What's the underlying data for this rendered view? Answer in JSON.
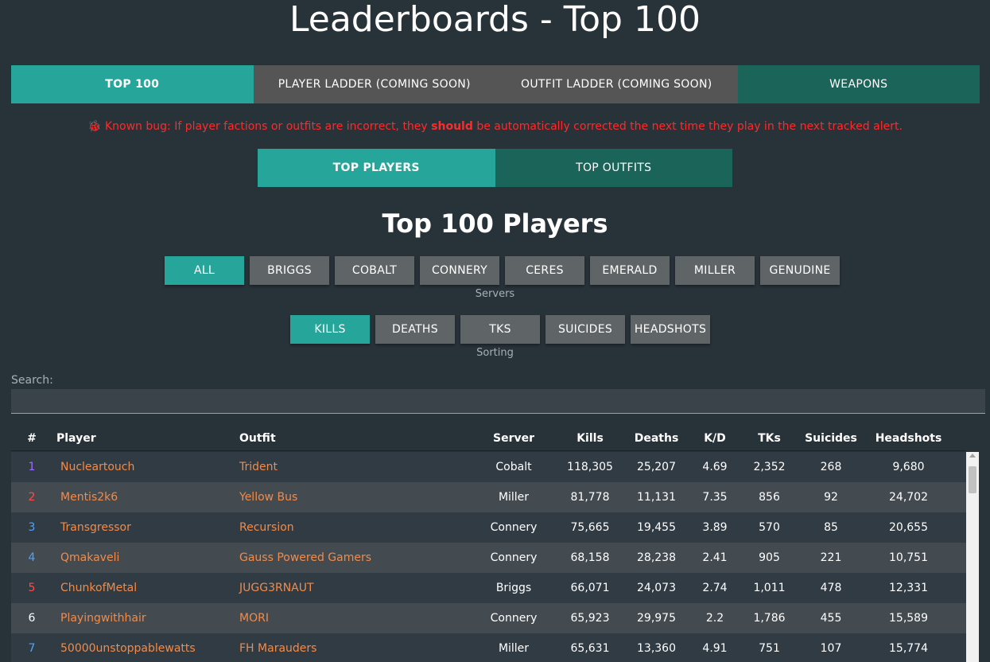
{
  "page_title": "Leaderboards - Top 100",
  "main_tabs": [
    {
      "label": "TOP 100"
    },
    {
      "label": "PLAYER LADDER (COMING SOON)"
    },
    {
      "label": "OUTFIT LADDER (COMING SOON)"
    },
    {
      "label": "WEAPONS"
    }
  ],
  "notice": {
    "icon": "bug-icon",
    "glyph": "🐞",
    "prefix": " Known bug: If player factions or outfits are incorrect, they ",
    "emphasis": "should",
    "suffix": " be automatically corrected the next time they play in the next tracked alert."
  },
  "sub_tabs": [
    {
      "label": "TOP PLAYERS"
    },
    {
      "label": "TOP OUTFITS"
    }
  ],
  "section_title": "Top 100 Players",
  "servers": {
    "buttons": [
      "ALL",
      "BRIGGS",
      "COBALT",
      "CONNERY",
      "CERES",
      "EMERALD",
      "MILLER",
      "GENUDINE"
    ],
    "selected": "ALL",
    "caption": "Servers"
  },
  "sorting": {
    "buttons": [
      "KILLS",
      "DEATHS",
      "TKS",
      "SUICIDES",
      "HEADSHOTS"
    ],
    "selected": "KILLS",
    "caption": "Sorting"
  },
  "search": {
    "label": "Search:",
    "value": "",
    "placeholder": ""
  },
  "table": {
    "headers": {
      "rank": "#",
      "player": "Player",
      "outfit": "Outfit",
      "server": "Server",
      "kills": "Kills",
      "deaths": "Deaths",
      "kd": "K/D",
      "tks": "TKs",
      "suicides": "Suicides",
      "headshots": "Headshots"
    },
    "rows": [
      {
        "rank": "1",
        "faction": "vs",
        "player": "Nucleartouch",
        "outfit": "Trident",
        "server": "Cobalt",
        "kills": "118,305",
        "deaths": "25,207",
        "kd": "4.69",
        "tks": "2,352",
        "suicides": "268",
        "headshots": "9,680"
      },
      {
        "rank": "2",
        "faction": "tr",
        "player": "Mentis2k6",
        "outfit": "Yellow Bus",
        "server": "Miller",
        "kills": "81,778",
        "deaths": "11,131",
        "kd": "7.35",
        "tks": "856",
        "suicides": "92",
        "headshots": "24,702"
      },
      {
        "rank": "3",
        "faction": "nc",
        "player": "Transgressor",
        "outfit": "Recursion",
        "server": "Connery",
        "kills": "75,665",
        "deaths": "19,455",
        "kd": "3.89",
        "tks": "570",
        "suicides": "85",
        "headshots": "20,655"
      },
      {
        "rank": "4",
        "faction": "nc",
        "player": "Qmakaveli",
        "outfit": "Gauss Powered Gamers",
        "server": "Connery",
        "kills": "68,158",
        "deaths": "28,238",
        "kd": "2.41",
        "tks": "905",
        "suicides": "221",
        "headshots": "10,751"
      },
      {
        "rank": "5",
        "faction": "tr",
        "player": "ChunkofMetal",
        "outfit": "JUGG3RNAUT",
        "server": "Briggs",
        "kills": "66,071",
        "deaths": "24,073",
        "kd": "2.74",
        "tks": "1,011",
        "suicides": "478",
        "headshots": "12,331"
      },
      {
        "rank": "6",
        "faction": "ns",
        "player": "Playingwithhair",
        "outfit": "MORI",
        "server": "Connery",
        "kills": "65,923",
        "deaths": "29,975",
        "kd": "2.2",
        "tks": "1,786",
        "suicides": "455",
        "headshots": "15,589"
      },
      {
        "rank": "7",
        "faction": "nc",
        "player": "50000unstoppablewatts",
        "outfit": "FH Marauders",
        "server": "Miller",
        "kills": "65,631",
        "deaths": "13,360",
        "kd": "4.91",
        "tks": "751",
        "suicides": "107",
        "headshots": "15,774"
      }
    ]
  },
  "colors": {
    "background": "#283239",
    "accent": "#26a69a",
    "accent_dark": "#1b6459",
    "tab_grey": "#555555",
    "button_grey": "#5f6566",
    "link": "#f28b4a",
    "notice_red": "#ff2a2a",
    "faction_vs": "#9b6dff",
    "faction_tr": "#ff4b4b",
    "faction_nc": "#4da3ff"
  }
}
